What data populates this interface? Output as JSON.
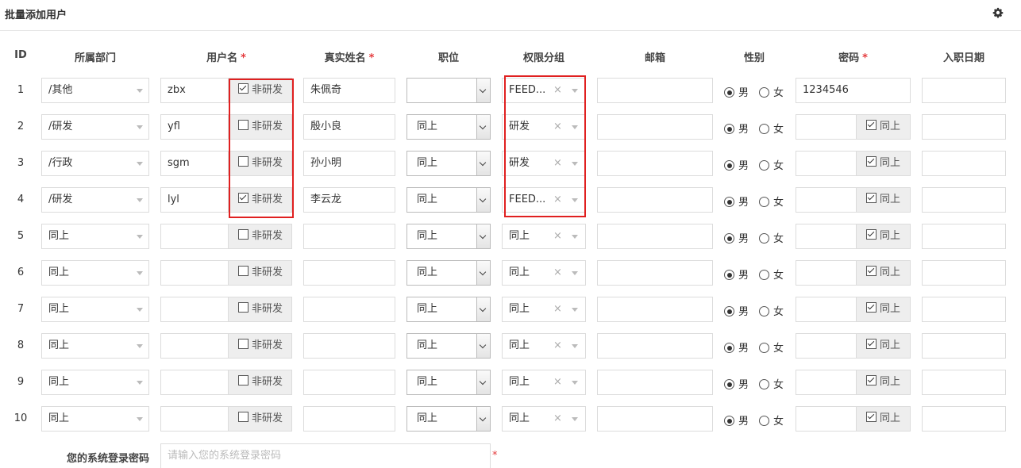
{
  "page": {
    "title": "批量添加用户"
  },
  "headers": {
    "id": "ID",
    "department": "所属部门",
    "username": "用户名",
    "realname": "真实姓名",
    "position": "职位",
    "group": "权限分组",
    "email": "邮箱",
    "gender": "性别",
    "password": "密码",
    "join_date": "入职日期",
    "required_mark": "*"
  },
  "labels": {
    "non_rd": "非研发",
    "same_as_above": "同上",
    "male": "男",
    "female": "女",
    "clear": "×"
  },
  "rows": [
    {
      "id": "1",
      "dept": "/其他",
      "user": "zbx",
      "non_rd": true,
      "real": "朱佩奇",
      "pos": "",
      "group": "FEED...",
      "pwd": "1234546",
      "pwd_same": false
    },
    {
      "id": "2",
      "dept": "/研发",
      "user": "yfl",
      "non_rd": false,
      "real": "殷小良",
      "pos": "同上",
      "group": "研发",
      "pwd": "",
      "pwd_same": true
    },
    {
      "id": "3",
      "dept": "/行政",
      "user": "sgm",
      "non_rd": false,
      "real": "孙小明",
      "pos": "同上",
      "group": "研发",
      "pwd": "",
      "pwd_same": true
    },
    {
      "id": "4",
      "dept": "/研发",
      "user": "lyl",
      "non_rd": true,
      "real": "李云龙",
      "pos": "同上",
      "group": "FEED...",
      "pwd": "",
      "pwd_same": true
    },
    {
      "id": "5",
      "dept": "同上",
      "user": "",
      "non_rd": false,
      "real": "",
      "pos": "同上",
      "group": "同上",
      "pwd": "",
      "pwd_same": true
    },
    {
      "id": "6",
      "dept": "同上",
      "user": "",
      "non_rd": false,
      "real": "",
      "pos": "同上",
      "group": "同上",
      "pwd": "",
      "pwd_same": true
    },
    {
      "id": "7",
      "dept": "同上",
      "user": "",
      "non_rd": false,
      "real": "",
      "pos": "同上",
      "group": "同上",
      "pwd": "",
      "pwd_same": true
    },
    {
      "id": "8",
      "dept": "同上",
      "user": "",
      "non_rd": false,
      "real": "",
      "pos": "同上",
      "group": "同上",
      "pwd": "",
      "pwd_same": true
    },
    {
      "id": "9",
      "dept": "同上",
      "user": "",
      "non_rd": false,
      "real": "",
      "pos": "同上",
      "group": "同上",
      "pwd": "",
      "pwd_same": true
    },
    {
      "id": "10",
      "dept": "同上",
      "user": "",
      "non_rd": false,
      "real": "",
      "pos": "同上",
      "group": "同上",
      "pwd": "",
      "pwd_same": true
    }
  ],
  "footer": {
    "label": "您的系统登录密码",
    "placeholder": "请输入您的系统登录密码",
    "required_mark": "*"
  }
}
